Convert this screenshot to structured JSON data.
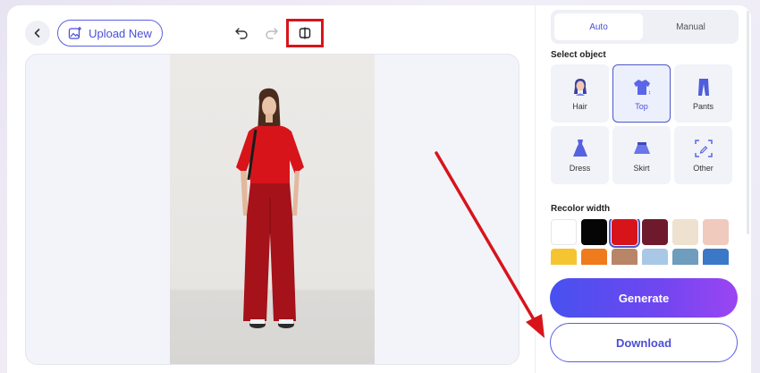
{
  "toolbar": {
    "upload_label": "Upload New",
    "icons": [
      "back-icon",
      "image-upload-icon",
      "undo-icon",
      "redo-icon",
      "compare-icon"
    ]
  },
  "panel": {
    "tabs": [
      {
        "label": "Auto",
        "active": true
      },
      {
        "label": "Manual",
        "active": false
      }
    ],
    "select_object_title": "Select object",
    "objects": [
      {
        "label": "Hair",
        "icon": "hair-icon",
        "selected": false
      },
      {
        "label": "Top",
        "icon": "top-icon",
        "selected": true
      },
      {
        "label": "Pants",
        "icon": "pants-icon",
        "selected": false
      },
      {
        "label": "Dress",
        "icon": "dress-icon",
        "selected": false
      },
      {
        "label": "Skirt",
        "icon": "skirt-icon",
        "selected": false
      },
      {
        "label": "Other",
        "icon": "other-icon",
        "selected": false
      }
    ],
    "recolor_title": "Recolor width",
    "swatches": [
      "#ffffff",
      "#050505",
      "#d8141b",
      "#6e1a2c",
      "#efe1cf",
      "#f0cabd",
      "#f5c531",
      "#ef7b1c",
      "#b98569",
      "#a9c8e6",
      "#6e9dbd",
      "#3b78c8"
    ],
    "selected_swatch": "#d8141b",
    "generate_label": "Generate",
    "download_label": "Download"
  },
  "colors": {
    "accent": "#4b4fd6",
    "highlight_red": "#d8141b"
  }
}
